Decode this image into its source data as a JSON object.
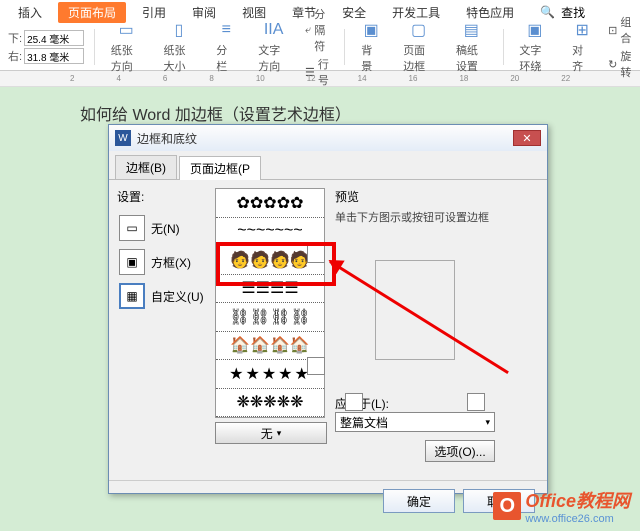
{
  "ribbon": {
    "tabs": [
      "插入",
      "页面布局",
      "引用",
      "审阅",
      "视图",
      "章节",
      "安全",
      "开发工具",
      "特色应用"
    ],
    "active_tab": "页面布局",
    "search": "查找",
    "margin_top_label": "下:",
    "margin_top_value": "25.4 毫米",
    "margin_left_label": "右:",
    "margin_left_value": "31.8 毫米",
    "orient": "纸张方向",
    "size": "纸张大小",
    "columns": "分栏",
    "textdir": "文字方向",
    "break": "分隔符",
    "lineno": "行号",
    "bg": "背景",
    "border": "页面边框",
    "paper": "稿纸设置",
    "textfx": "文字环绕",
    "align": "对齐",
    "group": "组合",
    "rotate": "旋转"
  },
  "ruler": [
    "2",
    "4",
    "6",
    "8",
    "10",
    "12",
    "14",
    "16",
    "18",
    "20",
    "22"
  ],
  "doc": {
    "title": "如何给 Word 加边框（设置艺术边框）"
  },
  "dialog": {
    "title": "边框和底纹",
    "tabs": {
      "border": "边框(B)",
      "pageborder": "页面边框(P"
    },
    "settings_label": "设置:",
    "none": "无(N)",
    "box": "方框(X)",
    "custom": "自定义(U)",
    "none_btn": "无",
    "preview_label": "预览",
    "preview_hint": "单击下方图示或按钮可设置边框",
    "apply_label": "应用于(L):",
    "apply_value": "整篇文档",
    "options": "选项(O)...",
    "ok": "确定",
    "cancel": "取消"
  },
  "watermark": {
    "main": "Office教程网",
    "sub": "www.office26.com"
  }
}
